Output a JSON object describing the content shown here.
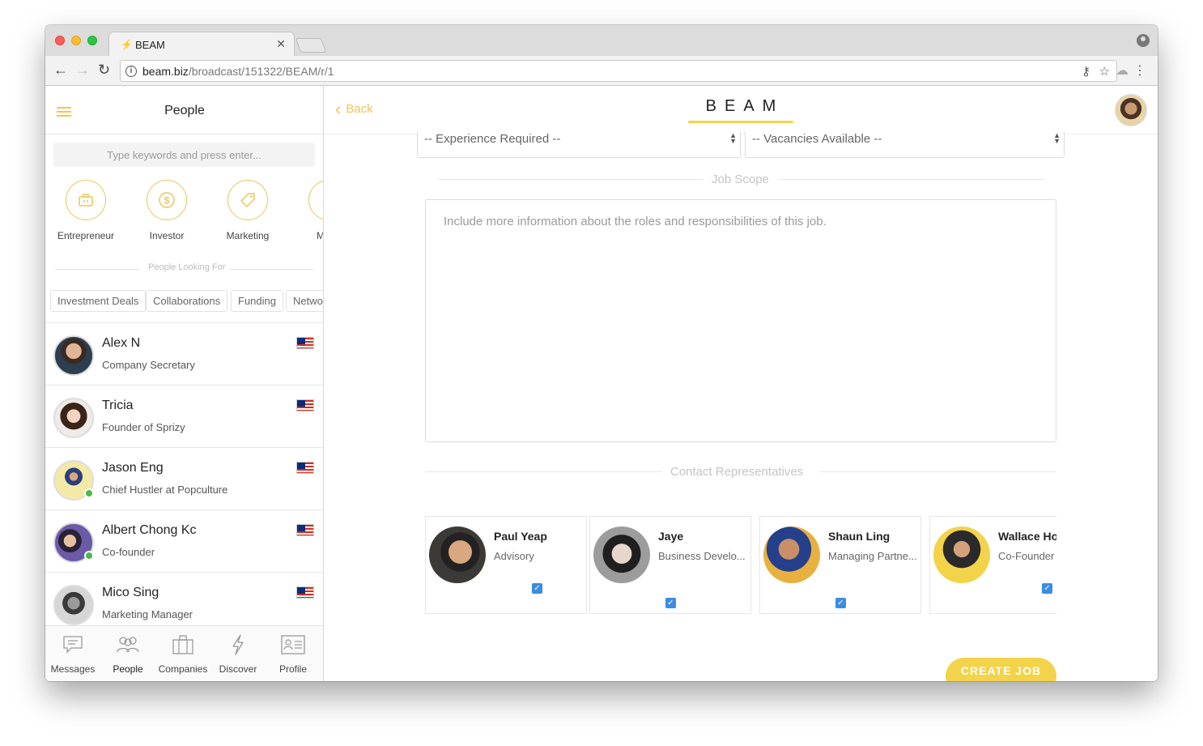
{
  "browser": {
    "tab_title": "BEAM",
    "tab_icon": "bolt-icon",
    "url_domain": "beam.biz",
    "url_path": "/broadcast/151322/BEAM/r/1"
  },
  "sidebar": {
    "title": "People",
    "search_placeholder": "Type keywords and press enter...",
    "categories": [
      {
        "label": "Entrepreneur",
        "icon": "briefcase-icon"
      },
      {
        "label": "Investor",
        "icon": "dollar-icon"
      },
      {
        "label": "Marketing",
        "icon": "tag-icon"
      },
      {
        "label": "Mana",
        "icon": "arrow-icon"
      }
    ],
    "looking_for_label": "People Looking For",
    "chips": [
      "Investment Deals",
      "Collaborations",
      "Funding",
      "Netwo"
    ],
    "people": [
      {
        "name": "Alex N",
        "title": "Company Secretary",
        "online": false
      },
      {
        "name": "Tricia",
        "title": "Founder of Sprizy",
        "online": false
      },
      {
        "name": "Jason Eng",
        "title": "Chief Hustler at Popculture",
        "online": true
      },
      {
        "name": "Albert Chong Kc",
        "title": "Co-founder",
        "online": true
      },
      {
        "name": "Mico Sing",
        "title": "Marketing Manager",
        "online": false
      }
    ],
    "bottom_nav": [
      {
        "label": "Messages",
        "icon": "messages-icon"
      },
      {
        "label": "People",
        "icon": "people-icon"
      },
      {
        "label": "Companies",
        "icon": "briefcase-icon"
      },
      {
        "label": "Discover",
        "icon": "lightning-icon"
      },
      {
        "label": "Profile",
        "icon": "profile-card-icon"
      }
    ]
  },
  "main": {
    "back_label": "Back",
    "logo_text": "BEAM",
    "experience_select": "-- Experience Required --",
    "vacancies_select": "-- Vacancies Available --",
    "job_scope_title": "Job Scope",
    "job_scope_placeholder": "Include more information about the roles and responsibilities of this job.",
    "contact_title": "Contact Representatives",
    "representatives": [
      {
        "name": "Paul Yeap",
        "role": "Advisory",
        "checked": true
      },
      {
        "name": "Jaye",
        "role": "Business Develo...",
        "checked": true
      },
      {
        "name": "Shaun Ling",
        "role": "Managing Partne...",
        "checked": true
      },
      {
        "name": "Wallace Ho",
        "role": "Co-Founder",
        "checked": true
      }
    ],
    "create_button": "CREATE JOB"
  },
  "colors": {
    "accent": "#F3D34A",
    "accent_text": "#E9C65D",
    "checkbox": "#3B8DE3",
    "online": "#4CB849"
  }
}
